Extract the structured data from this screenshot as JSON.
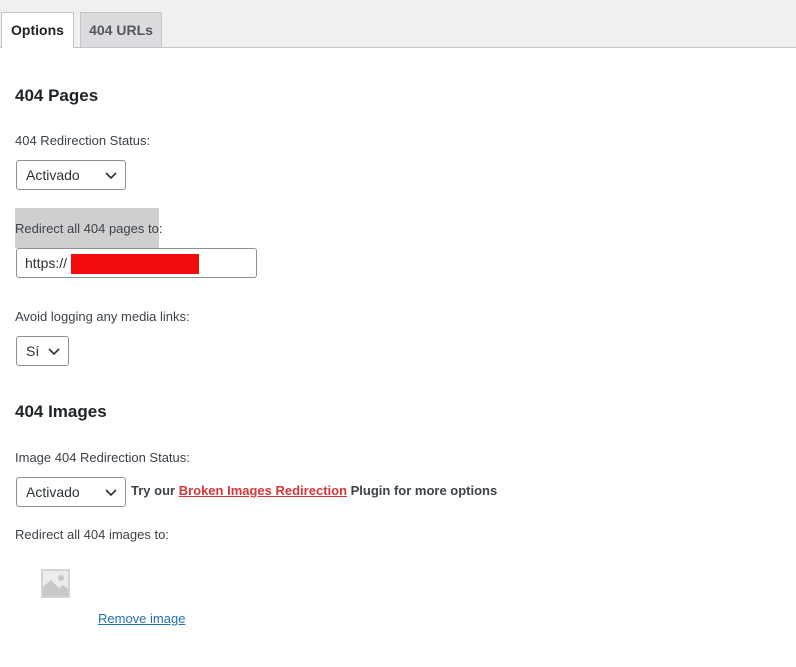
{
  "tabs": [
    {
      "label": "Options",
      "active": true
    },
    {
      "label": "404 URLs",
      "active": false
    }
  ],
  "pages_section": {
    "heading": "404 Pages",
    "status_label": "404 Redirection Status:",
    "status_value": "Activado",
    "redirect_label": "Redirect all 404 pages to:",
    "redirect_value": "https://",
    "avoid_label": "Avoid logging any media links:",
    "avoid_value": "Sí"
  },
  "images_section": {
    "heading": "404 Images",
    "status_label": "Image 404 Redirection Status:",
    "status_value": "Activado",
    "promo_prefix": "Try our ",
    "promo_link": "Broken Images Redirection",
    "promo_suffix": " Plugin for more options",
    "redirect_label": "Redirect all 404 images to:",
    "remove_label": "Remove image"
  },
  "colors": {
    "tab_bar": "#f0f0f1",
    "link": "#2271b1",
    "promo_link": "#d63638",
    "redaction": "#f30c0c",
    "highlight": "#cfcfcf"
  }
}
